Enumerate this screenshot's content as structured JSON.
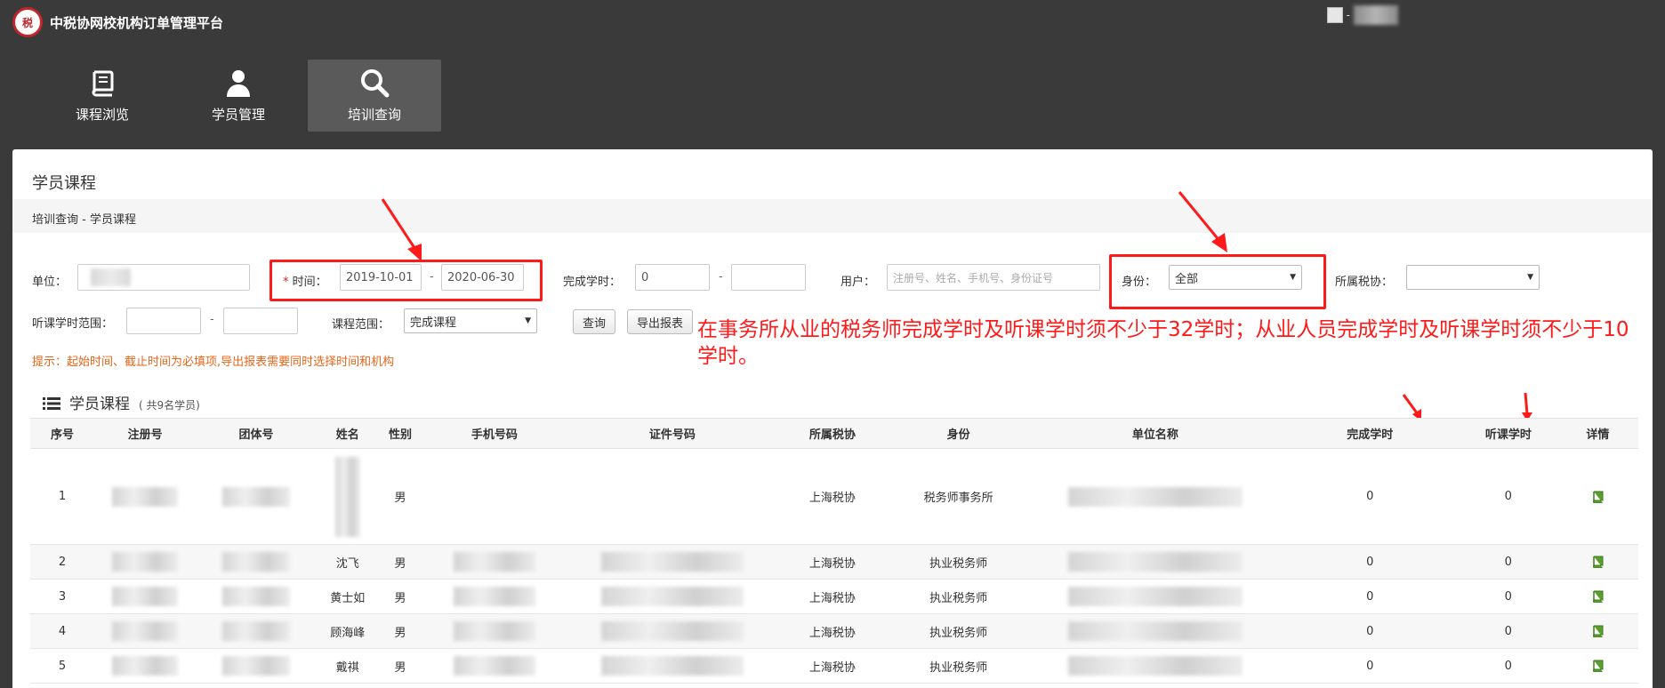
{
  "app": {
    "title": "中税协网校机构订单管理平台",
    "logo_text": "税"
  },
  "nav": [
    {
      "label": "课程浏览",
      "icon": "book-icon"
    },
    {
      "label": "学员管理",
      "icon": "user-icon"
    },
    {
      "label": "培训查询",
      "icon": "search-icon"
    }
  ],
  "user": {
    "separator": "-"
  },
  "panel": {
    "title": "学员课程",
    "breadcrumb": "培训查询 - 学员课程"
  },
  "filters": {
    "unit_label": "单位：",
    "time_required": "*",
    "time_label": "时间：",
    "time_start": "2019-10-01",
    "time_end": "2020-06-30",
    "range_sep": "-",
    "hours_label": "完成学时：",
    "hours_min": "0",
    "user_label": "用户：",
    "user_placeholder": "注册号、姓名、手机号、身份证号",
    "identity_label": "身份：",
    "identity_value": "全部",
    "assoc_label": "所属税协：",
    "listen_label": "听课学时范围：",
    "scope_label": "课程范围：",
    "scope_value": "完成课程",
    "query_button": "查询",
    "export_button": "导出报表"
  },
  "hint": "提示：起始时间、截止时间为必填项,导出报表需要同时选择时间和机构",
  "annotation": "在事务所从业的税务师完成学时及听课学时须不少于32学时；从业人员完成学时及听课学时须不少于10学时。",
  "section": {
    "title": "学员课程",
    "count": "( 共9名学员)"
  },
  "table": {
    "headers": [
      "序号",
      "注册号",
      "团体号",
      "姓名",
      "性别",
      "手机号码",
      "证件号码",
      "所属税协",
      "身份",
      "单位名称",
      "完成学时",
      "听课学时",
      "详情"
    ],
    "rows": [
      {
        "no": "1",
        "name": "",
        "gender": "男",
        "assoc": "上海税协",
        "identity": "税务师事务所",
        "done": "0",
        "listen": "0"
      },
      {
        "no": "2",
        "name": "沈飞",
        "gender": "男",
        "assoc": "上海税协",
        "identity": "执业税务师",
        "done": "0",
        "listen": "0"
      },
      {
        "no": "3",
        "name": "黄士如",
        "gender": "男",
        "assoc": "上海税协",
        "identity": "执业税务师",
        "done": "0",
        "listen": "0"
      },
      {
        "no": "4",
        "name": "顾海峰",
        "gender": "男",
        "assoc": "上海税协",
        "identity": "执业税务师",
        "done": "0",
        "listen": "0"
      },
      {
        "no": "5",
        "name": "戴祺",
        "gender": "男",
        "assoc": "上海税协",
        "identity": "执业税务师",
        "done": "0",
        "listen": "0"
      }
    ]
  },
  "colors": {
    "header_bg": "#3a3a3a",
    "annotation_red": "#ff1a1a",
    "hint_orange": "#e8651a",
    "detail_green": "#5a9e2f"
  }
}
